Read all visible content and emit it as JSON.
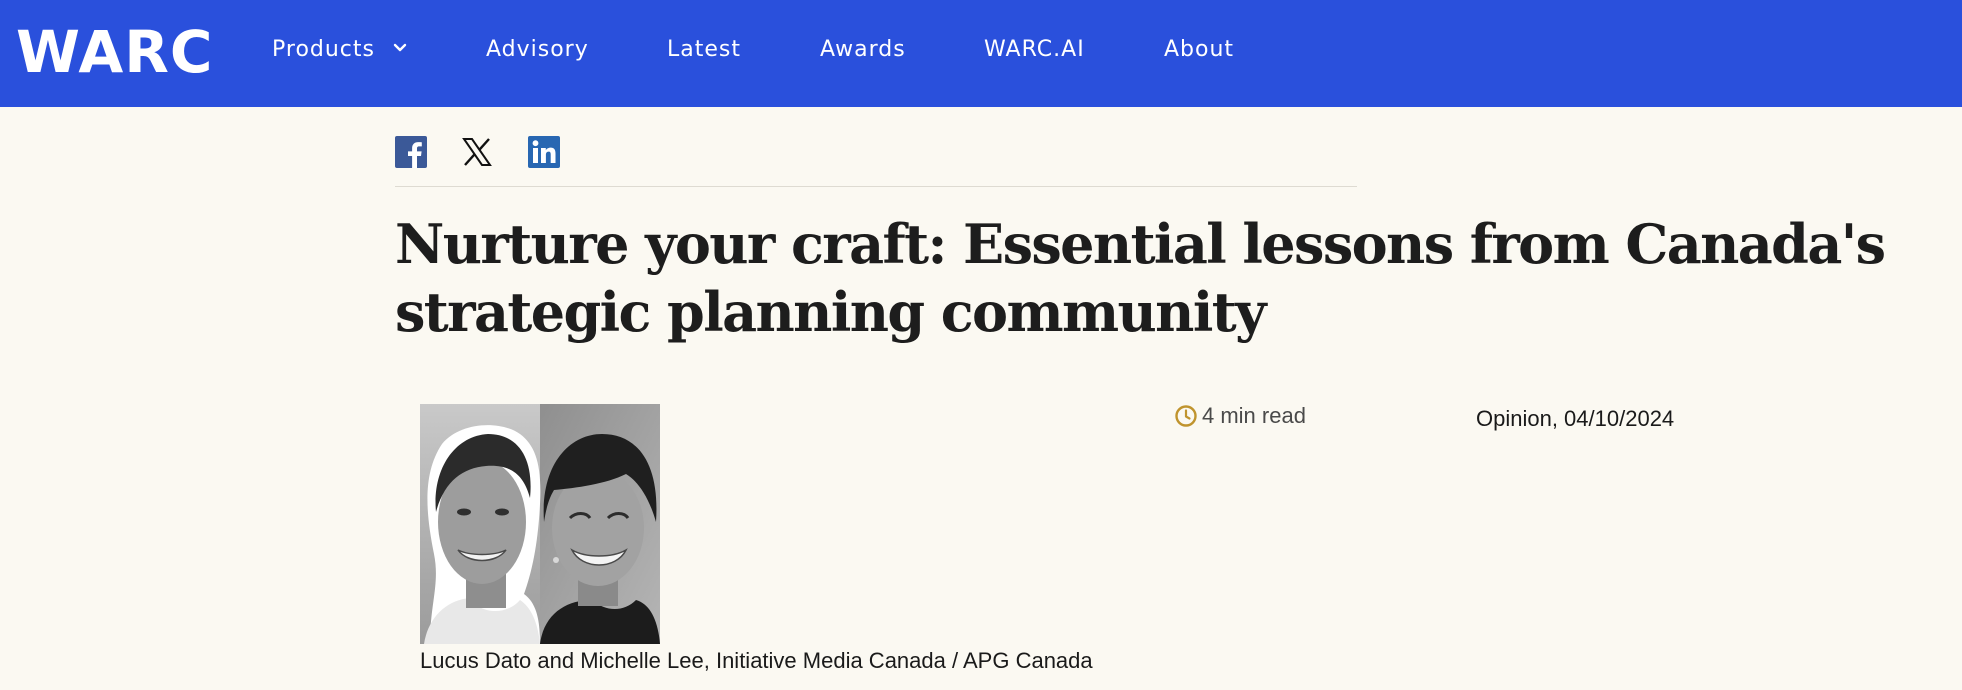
{
  "header": {
    "logo": "WARC",
    "nav": [
      {
        "label": "Products",
        "has_dropdown": true,
        "icon": "chevron-down-icon"
      },
      {
        "label": "Advisory"
      },
      {
        "label": "Latest"
      },
      {
        "label": "Awards"
      },
      {
        "label": "WARC.AI"
      },
      {
        "label": "About"
      }
    ],
    "background_color": "#2a50dc"
  },
  "share": {
    "icons": [
      "facebook-icon",
      "x-icon",
      "linkedin-icon"
    ],
    "facebook_color": "#3b5998",
    "linkedin_color": "#2867b2"
  },
  "article": {
    "title": "Nurture your craft: Essential lessons from Canada's strategic planning community",
    "read_time": "4 min read",
    "category_date": "Opinion, 04/10/2024",
    "byline": "Lucus Dato and Michelle Lee, Initiative Media Canada / APG Canada",
    "clock_icon": "clock-icon",
    "accent_color": "#c0942e"
  }
}
